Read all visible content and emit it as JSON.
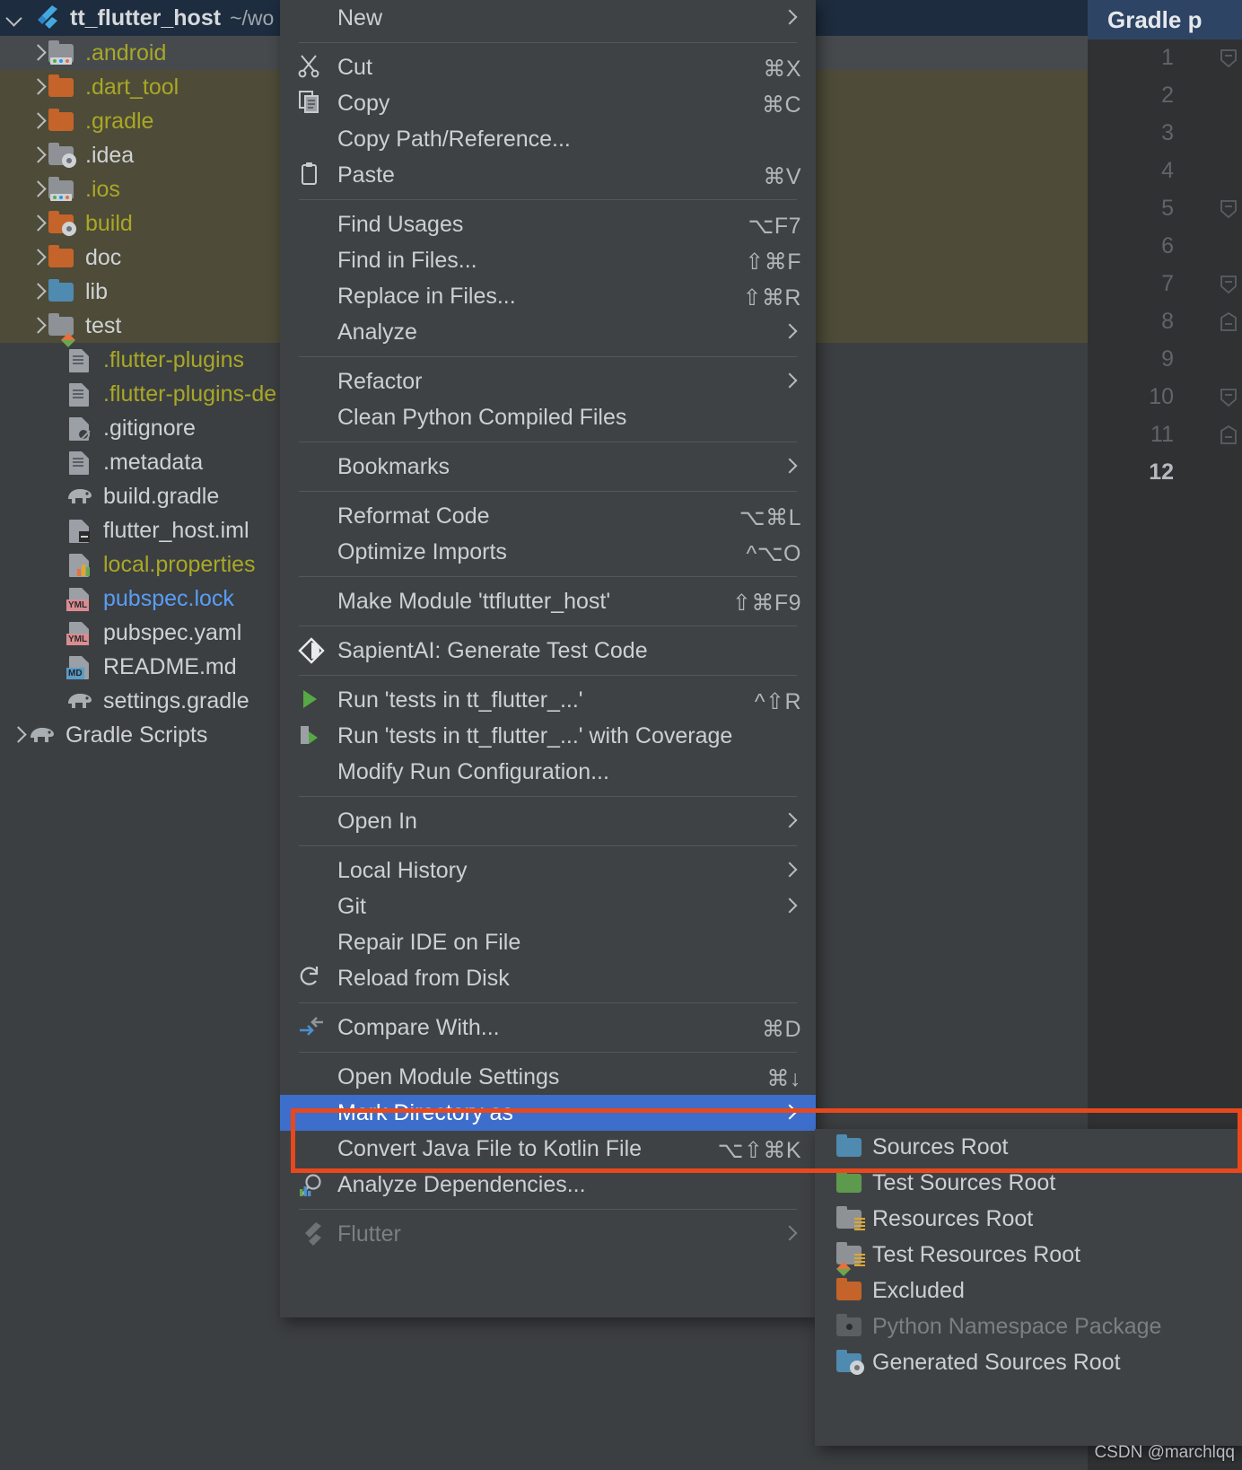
{
  "tree": {
    "header": {
      "title": "tt_flutter_host",
      "path": "~/wo",
      "icon": "flutter-logo-icon"
    },
    "rows": [
      {
        "label": ".android",
        "type": "folder",
        "folder": "gray",
        "badge": "dots",
        "color": "yellow",
        "expandable": true,
        "indent": 1,
        "state": "hover"
      },
      {
        "label": ".dart_tool",
        "type": "folder",
        "folder": "orange",
        "badge": "none",
        "color": "yellow",
        "expandable": true,
        "indent": 1,
        "state": "selected"
      },
      {
        "label": ".gradle",
        "type": "folder",
        "folder": "orange",
        "badge": "none",
        "color": "yellow",
        "expandable": true,
        "indent": 1,
        "state": "selected"
      },
      {
        "label": ".idea",
        "type": "folder",
        "folder": "gray",
        "badge": "fan",
        "color": "white",
        "expandable": true,
        "indent": 1,
        "state": "selected"
      },
      {
        "label": ".ios",
        "type": "folder",
        "folder": "gray",
        "badge": "dots",
        "color": "yellow",
        "expandable": true,
        "indent": 1,
        "state": "selected"
      },
      {
        "label": "build",
        "type": "folder",
        "folder": "orange",
        "badge": "fan",
        "color": "yellow",
        "expandable": true,
        "indent": 1,
        "state": "selected"
      },
      {
        "label": "doc",
        "type": "folder",
        "folder": "orange",
        "badge": "none",
        "color": "white",
        "expandable": true,
        "indent": 1,
        "state": "selected"
      },
      {
        "label": "lib",
        "type": "folder",
        "folder": "blue",
        "badge": "none",
        "color": "white",
        "expandable": true,
        "indent": 1,
        "state": "selected"
      },
      {
        "label": "test",
        "type": "folder",
        "folder": "gray",
        "badge": "diamond",
        "color": "white",
        "expandable": true,
        "indent": 1,
        "state": "selected"
      },
      {
        "label": ".flutter-plugins",
        "type": "file",
        "badge": "lines",
        "color": "yellow",
        "expandable": false,
        "indent": 2,
        "state": "none"
      },
      {
        "label": ".flutter-plugins-de",
        "type": "file",
        "badge": "lines",
        "color": "yellow",
        "expandable": false,
        "indent": 2,
        "state": "none"
      },
      {
        "label": ".gitignore",
        "type": "file",
        "badge": "ignore",
        "color": "white",
        "expandable": false,
        "indent": 2,
        "state": "none"
      },
      {
        "label": ".metadata",
        "type": "file",
        "badge": "lines",
        "color": "white",
        "expandable": false,
        "indent": 2,
        "state": "none"
      },
      {
        "label": "build.gradle",
        "type": "gradle",
        "badge": "none",
        "color": "white",
        "expandable": false,
        "indent": 2,
        "state": "none"
      },
      {
        "label": "flutter_host.iml",
        "type": "file",
        "badge": "iml",
        "color": "white",
        "expandable": false,
        "indent": 2,
        "state": "none"
      },
      {
        "label": "local.properties",
        "type": "file",
        "badge": "props",
        "color": "yellow",
        "expandable": false,
        "indent": 2,
        "state": "none"
      },
      {
        "label": "pubspec.lock",
        "type": "file",
        "badge": "yml",
        "color": "blue",
        "expandable": false,
        "indent": 2,
        "state": "none"
      },
      {
        "label": "pubspec.yaml",
        "type": "file",
        "badge": "yml",
        "color": "white",
        "expandable": false,
        "indent": 2,
        "state": "none"
      },
      {
        "label": "README.md",
        "type": "file",
        "badge": "md",
        "color": "white",
        "expandable": false,
        "indent": 2,
        "state": "none"
      },
      {
        "label": "settings.gradle",
        "type": "gradle",
        "badge": "none",
        "color": "white",
        "expandable": false,
        "indent": 2,
        "state": "none"
      },
      {
        "label": "Gradle Scripts",
        "type": "gradle",
        "badge": "none",
        "color": "white",
        "expandable": true,
        "indent": 0,
        "state": "none"
      }
    ]
  },
  "editor": {
    "tab_label": "Gradle p",
    "line_numbers": [
      1,
      2,
      3,
      4,
      5,
      6,
      7,
      8,
      9,
      10,
      11,
      12
    ],
    "current_line": 12,
    "fold_markers": [
      1,
      5,
      7,
      8,
      10,
      11
    ]
  },
  "context_menu": {
    "items": [
      {
        "label": "New",
        "shortcut": "",
        "submenu": true,
        "icon": "",
        "disabled": false,
        "selected": false
      },
      {
        "sep": true
      },
      {
        "label": "Cut",
        "shortcut": "⌘X",
        "submenu": false,
        "icon": "scissors-icon",
        "disabled": false,
        "selected": false
      },
      {
        "label": "Copy",
        "shortcut": "⌘C",
        "submenu": false,
        "icon": "copy-icon",
        "disabled": false,
        "selected": false
      },
      {
        "label": "Copy Path/Reference...",
        "shortcut": "",
        "submenu": false,
        "icon": "",
        "disabled": false,
        "selected": false
      },
      {
        "label": "Paste",
        "shortcut": "⌘V",
        "submenu": false,
        "icon": "paste-icon",
        "disabled": false,
        "selected": false
      },
      {
        "sep": true
      },
      {
        "label": "Find Usages",
        "shortcut": "⌥F7",
        "submenu": false,
        "icon": "",
        "disabled": false,
        "selected": false
      },
      {
        "label": "Find in Files...",
        "shortcut": "⇧⌘F",
        "submenu": false,
        "icon": "",
        "disabled": false,
        "selected": false
      },
      {
        "label": "Replace in Files...",
        "shortcut": "⇧⌘R",
        "submenu": false,
        "icon": "",
        "disabled": false,
        "selected": false
      },
      {
        "label": "Analyze",
        "shortcut": "",
        "submenu": true,
        "icon": "",
        "disabled": false,
        "selected": false
      },
      {
        "sep": true
      },
      {
        "label": "Refactor",
        "shortcut": "",
        "submenu": true,
        "icon": "",
        "disabled": false,
        "selected": false
      },
      {
        "label": "Clean Python Compiled Files",
        "shortcut": "",
        "submenu": false,
        "icon": "",
        "disabled": false,
        "selected": false
      },
      {
        "sep": true
      },
      {
        "label": "Bookmarks",
        "shortcut": "",
        "submenu": true,
        "icon": "",
        "disabled": false,
        "selected": false
      },
      {
        "sep": true
      },
      {
        "label": "Reformat Code",
        "shortcut": "⌥⌘L",
        "submenu": false,
        "icon": "",
        "disabled": false,
        "selected": false
      },
      {
        "label": "Optimize Imports",
        "shortcut": "^⌥O",
        "submenu": false,
        "icon": "",
        "disabled": false,
        "selected": false
      },
      {
        "sep": true
      },
      {
        "label": "Make Module 'ttflutter_host'",
        "shortcut": "⇧⌘F9",
        "submenu": false,
        "icon": "",
        "disabled": false,
        "selected": false
      },
      {
        "sep": true
      },
      {
        "label": "SapientAI: Generate Test Code",
        "shortcut": "",
        "submenu": false,
        "icon": "sapient-ai-icon",
        "disabled": false,
        "selected": false
      },
      {
        "sep": true
      },
      {
        "label": "Run 'tests in tt_flutter_...'",
        "shortcut": "^⇧R",
        "submenu": false,
        "icon": "run-icon",
        "disabled": false,
        "selected": false
      },
      {
        "label": "Run 'tests in tt_flutter_...' with Coverage",
        "shortcut": "",
        "submenu": false,
        "icon": "coverage-icon",
        "disabled": false,
        "selected": false
      },
      {
        "label": "Modify Run Configuration...",
        "shortcut": "",
        "submenu": false,
        "icon": "",
        "disabled": false,
        "selected": false
      },
      {
        "sep": true
      },
      {
        "label": "Open In",
        "shortcut": "",
        "submenu": true,
        "icon": "",
        "disabled": false,
        "selected": false
      },
      {
        "sep": true
      },
      {
        "label": "Local History",
        "shortcut": "",
        "submenu": true,
        "icon": "",
        "disabled": false,
        "selected": false
      },
      {
        "label": "Git",
        "shortcut": "",
        "submenu": true,
        "icon": "",
        "disabled": false,
        "selected": false
      },
      {
        "label": "Repair IDE on File",
        "shortcut": "",
        "submenu": false,
        "icon": "",
        "disabled": false,
        "selected": false
      },
      {
        "label": "Reload from Disk",
        "shortcut": "",
        "submenu": false,
        "icon": "reload-icon",
        "disabled": false,
        "selected": false
      },
      {
        "sep": true
      },
      {
        "label": "Compare With...",
        "shortcut": "⌘D",
        "submenu": false,
        "icon": "compare-icon",
        "disabled": false,
        "selected": false
      },
      {
        "sep": true
      },
      {
        "label": "Open Module Settings",
        "shortcut": "⌘↓",
        "submenu": false,
        "icon": "",
        "disabled": false,
        "selected": false
      },
      {
        "label": "Mark Directory as",
        "shortcut": "",
        "submenu": true,
        "icon": "",
        "disabled": false,
        "selected": true
      },
      {
        "label": "Convert Java File to Kotlin File",
        "shortcut": "⌥⇧⌘K",
        "submenu": false,
        "icon": "",
        "disabled": false,
        "selected": false
      },
      {
        "label": "Analyze Dependencies...",
        "shortcut": "",
        "submenu": false,
        "icon": "analyze-deps-icon",
        "disabled": false,
        "selected": false
      },
      {
        "sep": true
      },
      {
        "label": "Flutter",
        "shortcut": "",
        "submenu": true,
        "icon": "flutter-icon",
        "disabled": true,
        "selected": false
      }
    ]
  },
  "submenu": {
    "items": [
      {
        "label": "Sources Root",
        "folder": "blue",
        "badge": "none",
        "disabled": false
      },
      {
        "label": "Test Sources Root",
        "folder": "green",
        "badge": "none",
        "disabled": false
      },
      {
        "label": "Resources Root",
        "folder": "gray",
        "badge": "lines",
        "disabled": false
      },
      {
        "label": "Test Resources Root",
        "folder": "gray",
        "badge": "resdiam",
        "disabled": false
      },
      {
        "label": "Excluded",
        "folder": "orange",
        "badge": "none",
        "disabled": false
      },
      {
        "label": "Python Namespace Package",
        "folder": "dim",
        "badge": "dot",
        "disabled": true
      },
      {
        "label": "Generated Sources Root",
        "folder": "blue",
        "badge": "fan",
        "disabled": false
      }
    ]
  },
  "annotations": {
    "highlight_color": "#e8481c",
    "selection_color": "#3d6ecb"
  },
  "watermark": {
    "text": "CSDN @marchlqq"
  }
}
